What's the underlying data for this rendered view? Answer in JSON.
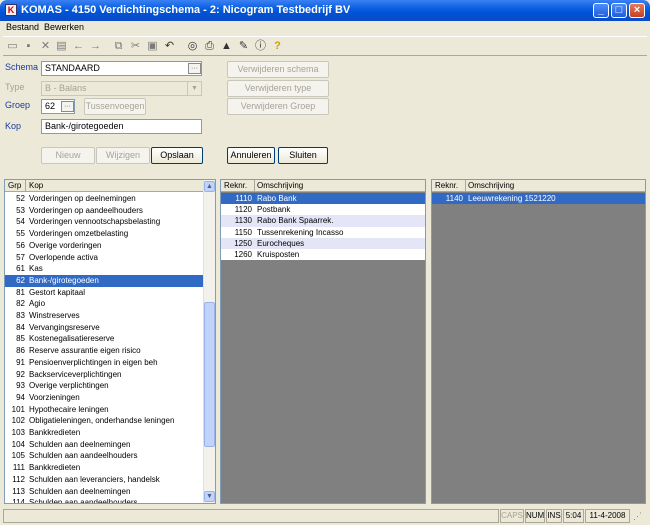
{
  "window": {
    "title": "KOMAS - 4150 Verdichtingschema - 2: Nicogram Testbedrijf BV"
  },
  "menu": [
    {
      "label": "Bestand"
    },
    {
      "label": "Bewerken"
    }
  ],
  "toolbar_icons": [
    "new-icon",
    "save-icon",
    "delete-icon",
    "print-preview-icon",
    "back-arrow-icon",
    "forward-arrow-icon",
    "copy-icon",
    "cut-icon",
    "paste-icon",
    "undo-icon",
    "binoculars-icon",
    "printer-icon",
    "stamp-icon",
    "edit-icon",
    "info-icon",
    "help-icon"
  ],
  "form": {
    "schema_label": "Schema",
    "schema_value": "STANDAARD",
    "type_label": "Type",
    "type_value": "B - Balans",
    "groep_label": "Groep",
    "groep_value": "62",
    "kop_label": "Kop",
    "kop_value": "Bank-/girotegoeden"
  },
  "buttons": {
    "tussenvoegen": "Tussenvoegen",
    "verwijderen_schema": "Verwijderen schema",
    "verwijderen_type": "Verwijderen type",
    "verwijderen_groep": "Verwijderen Groep",
    "nieuw": "Nieuw",
    "wijzigen": "Wijzigen",
    "opslaan": "Opslaan",
    "annuleren": "Annuleren",
    "sluiten": "Sluiten"
  },
  "left_grid": {
    "headers": {
      "grp": "Grp",
      "kop": "Kop"
    },
    "rows": [
      {
        "grp": "52",
        "kop": "Vorderingen op deelnemingen"
      },
      {
        "grp": "53",
        "kop": "Vorderingen op aandeelhouders"
      },
      {
        "grp": "54",
        "kop": "Vorderingen vennootschapsbelasting"
      },
      {
        "grp": "55",
        "kop": "Vorderingen omzetbelasting"
      },
      {
        "grp": "56",
        "kop": "Overige vorderingen"
      },
      {
        "grp": "57",
        "kop": "Overlopende activa"
      },
      {
        "grp": "61",
        "kop": "Kas"
      },
      {
        "grp": "62",
        "kop": "Bank-/girotegoeden"
      },
      {
        "grp": "81",
        "kop": "Gestort kapitaal"
      },
      {
        "grp": "82",
        "kop": "Agio"
      },
      {
        "grp": "83",
        "kop": "Winstreserves"
      },
      {
        "grp": "84",
        "kop": "Vervangingsreserve"
      },
      {
        "grp": "85",
        "kop": "Kostenegalisatiereserve"
      },
      {
        "grp": "86",
        "kop": "Reserve assurantie eigen risico"
      },
      {
        "grp": "91",
        "kop": "Pensioenverplichtingen in eigen beh"
      },
      {
        "grp": "92",
        "kop": "Backserviceverplichtingen"
      },
      {
        "grp": "93",
        "kop": "Overige verplichtingen"
      },
      {
        "grp": "94",
        "kop": "Voorzieningen"
      },
      {
        "grp": "101",
        "kop": "Hypothecaire leningen"
      },
      {
        "grp": "102",
        "kop": "Obligatieleningen, onderhandse leningen"
      },
      {
        "grp": "103",
        "kop": "Bankkredieten"
      },
      {
        "grp": "104",
        "kop": "Schulden aan deelnemingen"
      },
      {
        "grp": "105",
        "kop": "Schulden aan aandeelhouders"
      },
      {
        "grp": "111",
        "kop": "Bankkredieten"
      },
      {
        "grp": "112",
        "kop": "Schulden aan leveranciers, handelsk"
      },
      {
        "grp": "113",
        "kop": "Schulden aan deelnemingen"
      },
      {
        "grp": "114",
        "kop": "Schulden aan aandeelhouders"
      }
    ],
    "selected_index": 7
  },
  "mid_grid": {
    "headers": {
      "reknr": "Reknr.",
      "oms": "Omschrijving"
    },
    "rows": [
      {
        "reknr": "1110",
        "oms": "Rabo Bank"
      },
      {
        "reknr": "1120",
        "oms": "Postbank"
      },
      {
        "reknr": "1130",
        "oms": "Rabo Bank Spaarrek."
      },
      {
        "reknr": "1150",
        "oms": "Tussenrekening Incasso"
      },
      {
        "reknr": "1250",
        "oms": "Eurocheques"
      },
      {
        "reknr": "1260",
        "oms": "Kruisposten"
      }
    ],
    "selected_index": 0
  },
  "right_grid": {
    "headers": {
      "reknr": "Reknr.",
      "oms": "Omschrijving"
    },
    "rows": [
      {
        "reknr": "1140",
        "oms": "Leeuwrekening 1521220"
      }
    ],
    "selected_index": 0
  },
  "status": {
    "caps": "CAPS",
    "num": "NUM",
    "ins": "INS",
    "time": "5:04",
    "date": "11-4-2008"
  }
}
